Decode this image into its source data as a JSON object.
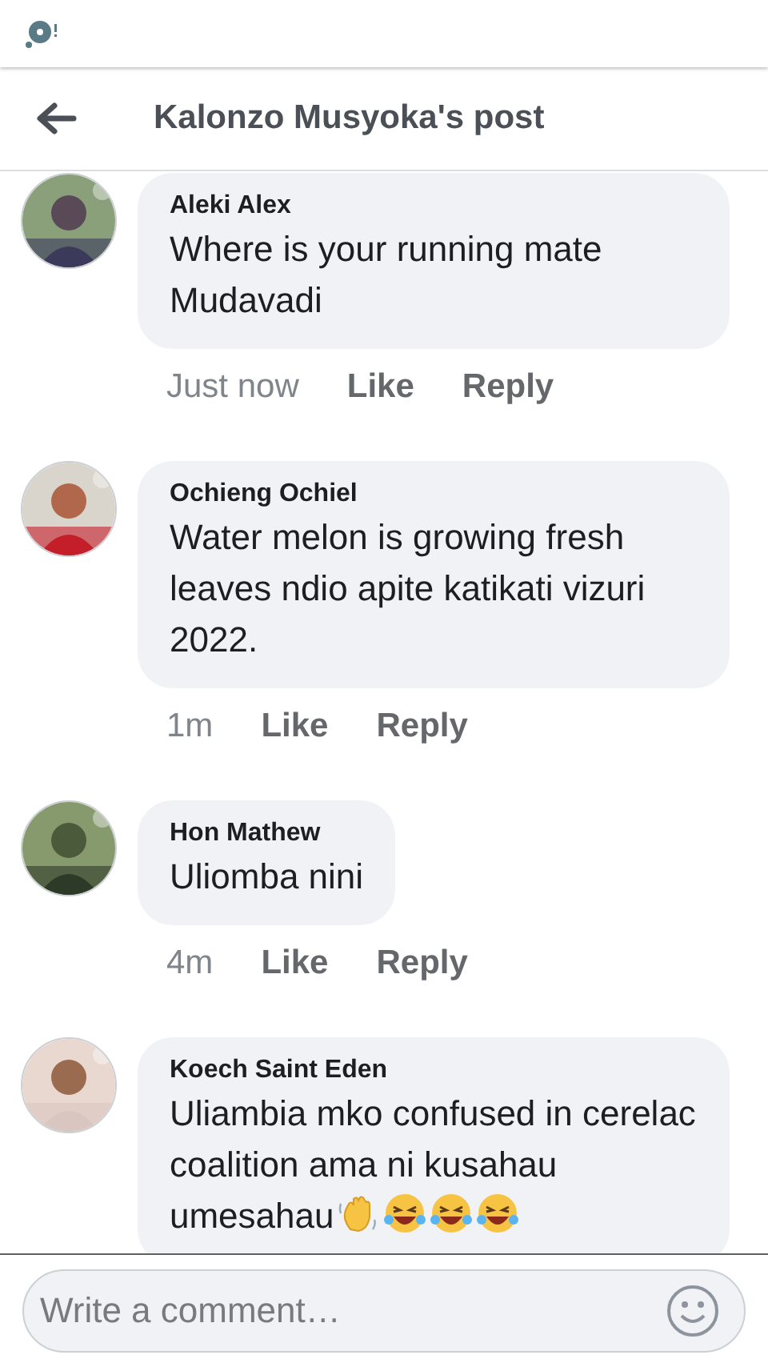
{
  "header": {
    "title": "Kalonzo Musyoka's post"
  },
  "comments": [
    {
      "author": "Aleki Alex",
      "text": "Where is your running mate Mudavadi",
      "time": "Just now",
      "actions": [
        "Like",
        "Reply"
      ]
    },
    {
      "author": "Ochieng Ochiel",
      "text": "Water melon is growing fresh leaves ndio apite katikati vizuri 2022.",
      "time": "1m",
      "actions": [
        "Like",
        "Reply"
      ]
    },
    {
      "author": "Hon Mathew",
      "text": "Uliomba nini",
      "time": "4m",
      "actions": [
        "Like",
        "Reply"
      ]
    },
    {
      "author": "Koech Saint Eden",
      "text": "Uliambia mko confused in cerelac coalition ama ni kusahau umesahau",
      "emojis": [
        {
          "kind": "wave"
        },
        {
          "kind": "laugh"
        },
        {
          "kind": "laugh"
        },
        {
          "kind": "laugh"
        }
      ]
    }
  ],
  "composer": {
    "placeholder": "Write a comment…"
  }
}
